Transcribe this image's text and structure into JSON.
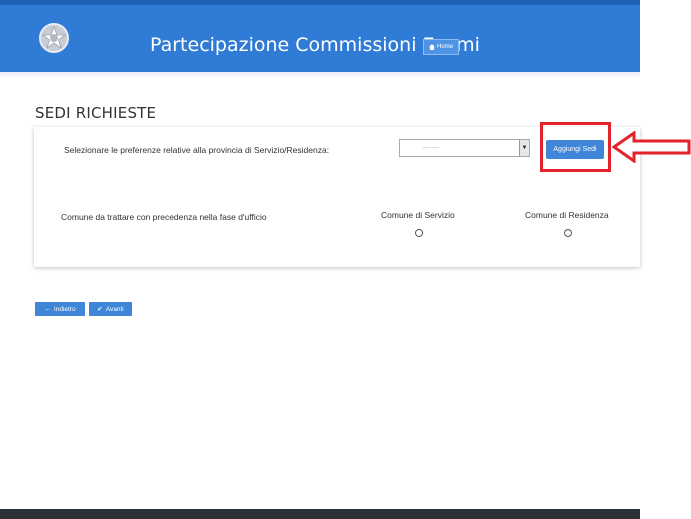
{
  "header": {
    "title": "Partecipazione Commissioni Esami",
    "home_label": "Home"
  },
  "section": {
    "title": "SEDI RICHIESTE"
  },
  "preferences": {
    "label": "Selezionare le preferenze relative alla provincia di Servizio/Residenza:",
    "select_value": "---- -----",
    "add_button": "Aggiungi Sedi"
  },
  "commune": {
    "label": "Comune da trattare con precedenza nella fase d'ufficio",
    "col_servizio": "Comune di Servizio",
    "col_residenza": "Comune di Residenza"
  },
  "nav": {
    "back": "Indietro",
    "next": "Avanti"
  },
  "colors": {
    "header": "#2f7bd6",
    "button": "#3f86d8",
    "annotation": "#e3232c",
    "footer": "#2b2f36"
  }
}
